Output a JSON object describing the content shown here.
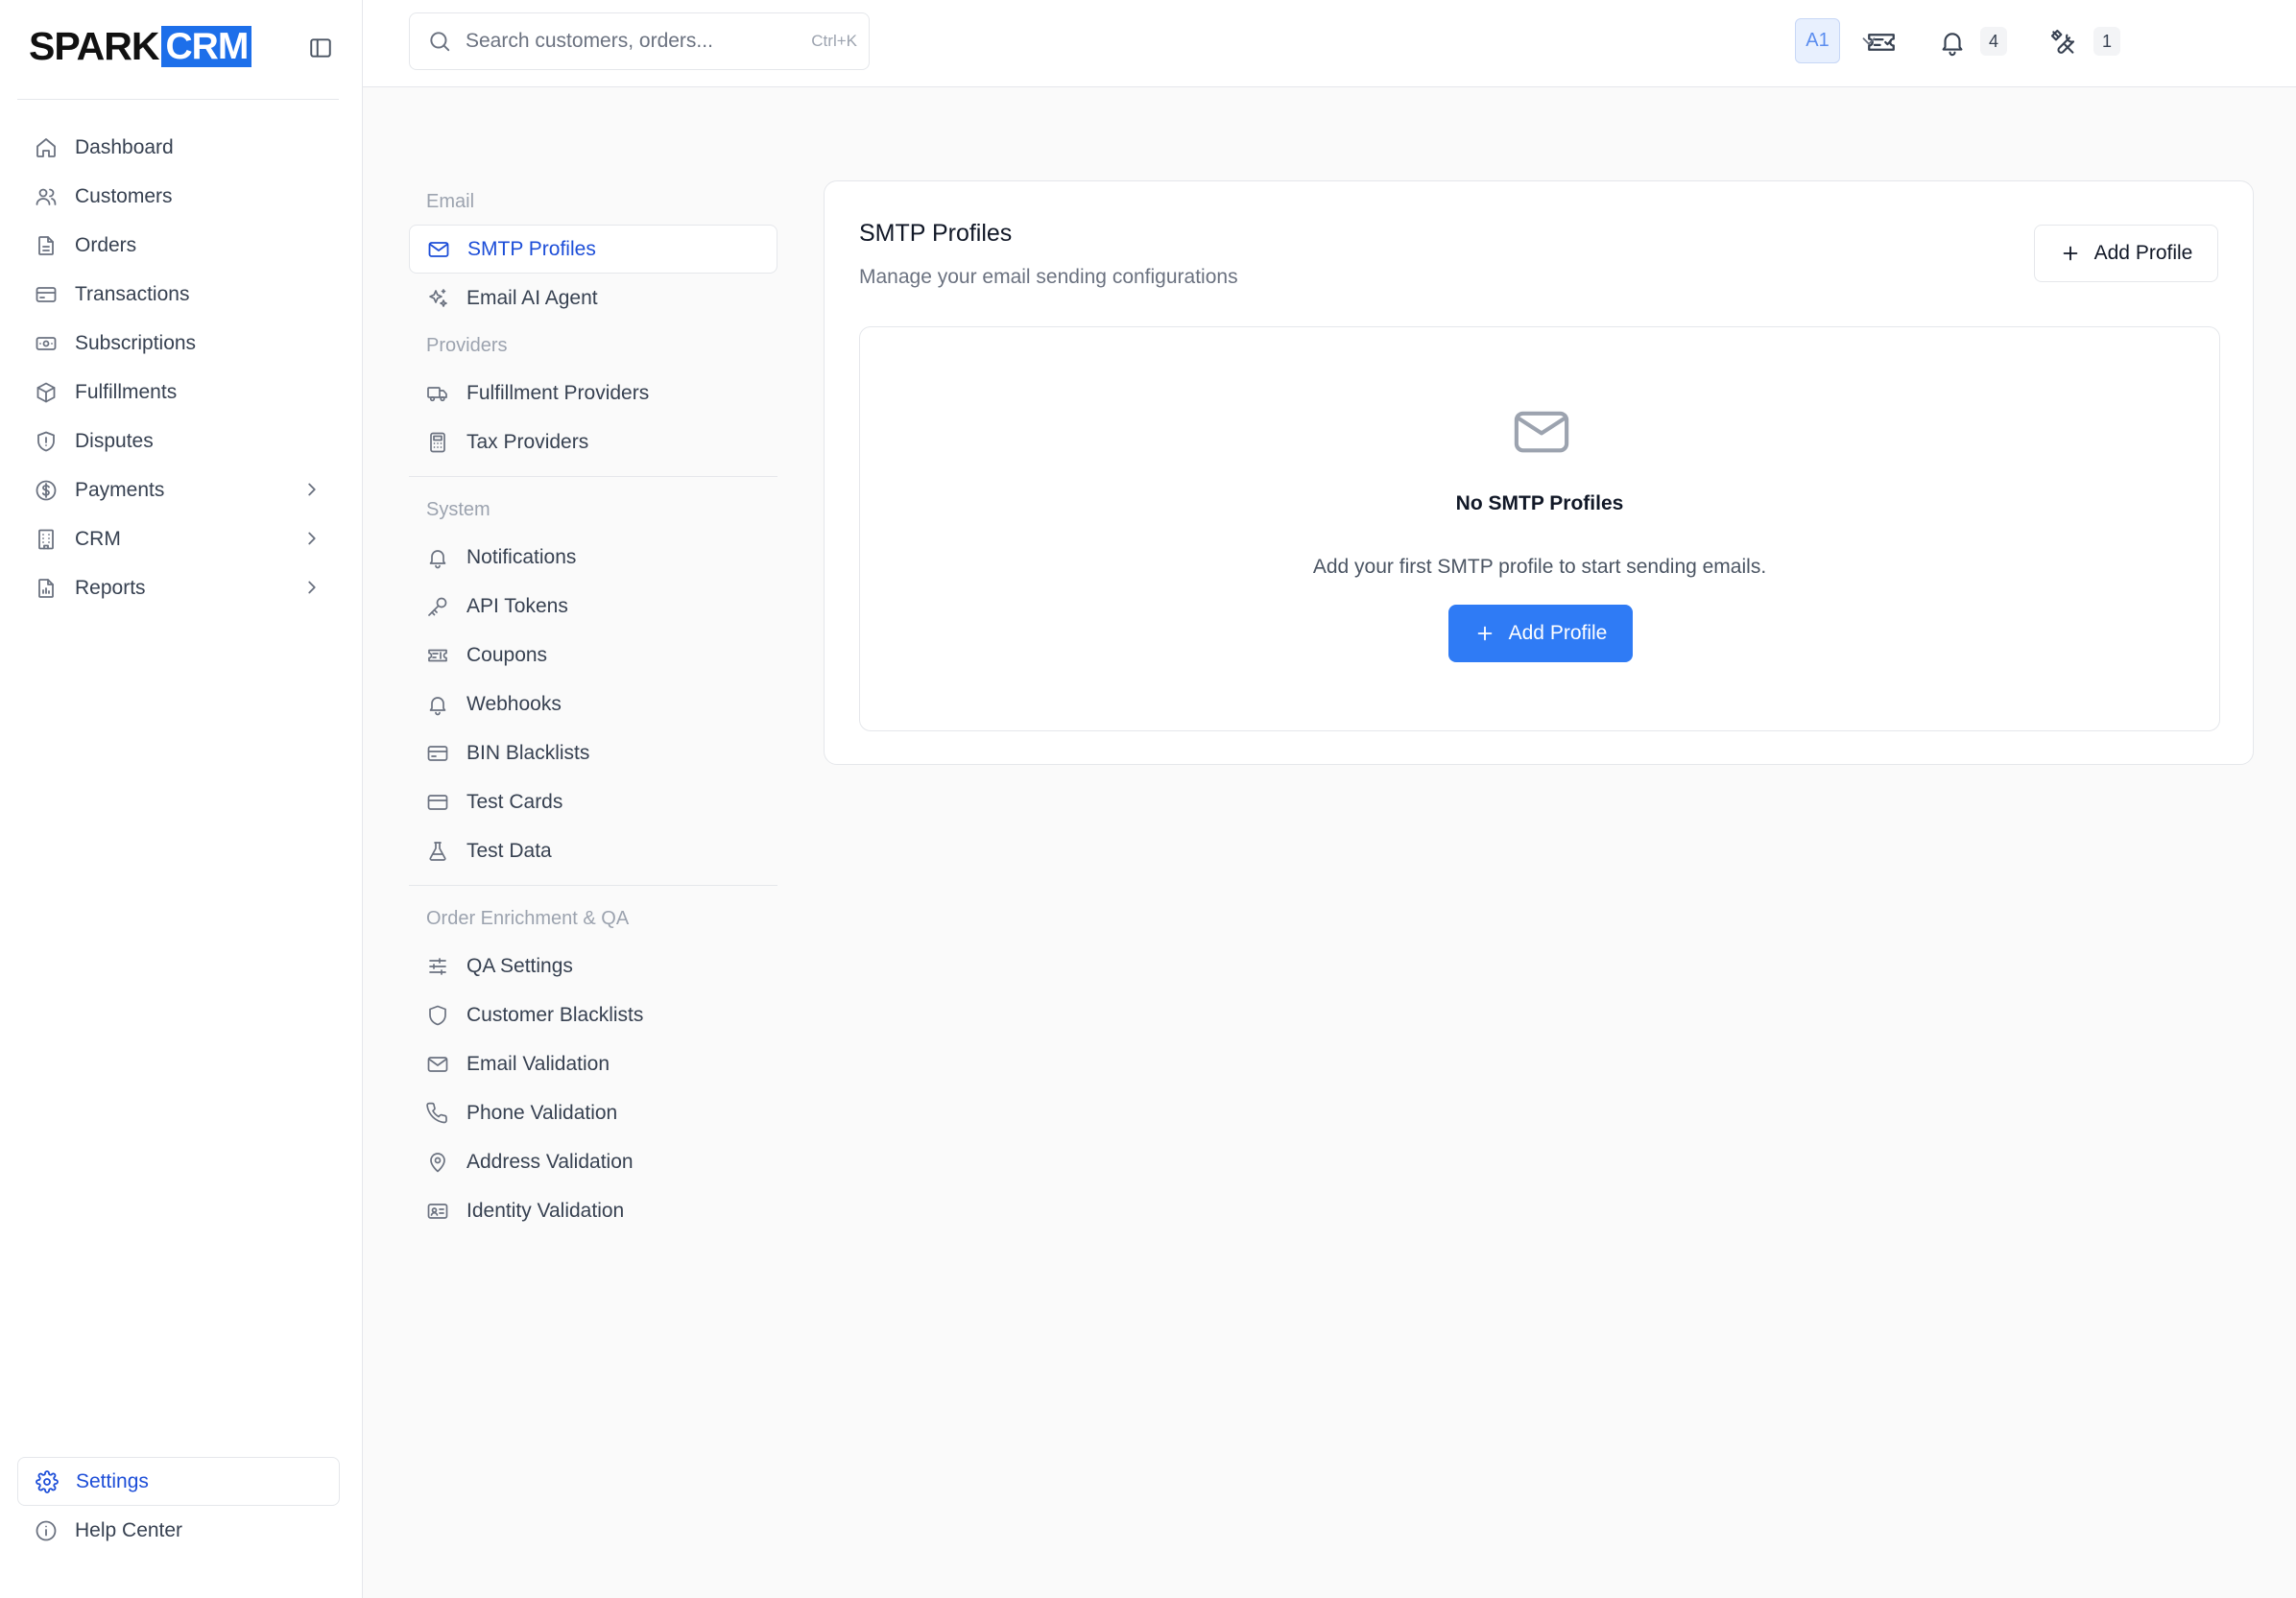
{
  "brand": {
    "part1": "SPARK",
    "part2": "CRM",
    "accent": "#1d6fea"
  },
  "sidebar": {
    "items": [
      {
        "label": "Dashboard",
        "icon": "home-icon"
      },
      {
        "label": "Customers",
        "icon": "users-icon"
      },
      {
        "label": "Orders",
        "icon": "file-icon"
      },
      {
        "label": "Transactions",
        "icon": "credit-card-icon"
      },
      {
        "label": "Subscriptions",
        "icon": "banknote-icon"
      },
      {
        "label": "Fulfillments",
        "icon": "package-icon"
      },
      {
        "label": "Disputes",
        "icon": "shield-icon"
      },
      {
        "label": "Payments",
        "icon": "dollar-circle-icon",
        "has_children": true
      },
      {
        "label": "CRM",
        "icon": "building-icon",
        "has_children": true
      },
      {
        "label": "Reports",
        "icon": "report-icon",
        "has_children": true
      }
    ],
    "bottom": [
      {
        "label": "Settings",
        "icon": "gear-icon",
        "active": true
      },
      {
        "label": "Help Center",
        "icon": "info-icon"
      }
    ]
  },
  "topbar": {
    "search_placeholder": "Search customers, orders...",
    "search_shortcut": "Ctrl+K",
    "notifications_count": "4",
    "tools_count": "1",
    "avatar_initials": "A1"
  },
  "settings_nav": {
    "sections": [
      {
        "heading": "Email",
        "items": [
          {
            "label": "SMTP Profiles",
            "icon": "mail-icon",
            "active": true
          },
          {
            "label": "Email AI Agent",
            "icon": "sparkles-icon"
          }
        ]
      },
      {
        "heading": "Providers",
        "items": [
          {
            "label": "Fulfillment Providers",
            "icon": "truck-icon"
          },
          {
            "label": "Tax Providers",
            "icon": "calculator-icon"
          }
        ]
      },
      {
        "heading": "System",
        "items": [
          {
            "label": "Notifications",
            "icon": "bell-icon"
          },
          {
            "label": "API Tokens",
            "icon": "key-icon"
          },
          {
            "label": "Coupons",
            "icon": "ticket-icon"
          },
          {
            "label": "Webhooks",
            "icon": "webhook-icon"
          },
          {
            "label": "BIN Blacklists",
            "icon": "credit-card-icon"
          },
          {
            "label": "Test Cards",
            "icon": "credit-card-icon"
          },
          {
            "label": "Test Data",
            "icon": "flask-icon"
          }
        ]
      },
      {
        "heading": "Order Enrichment & QA",
        "items": [
          {
            "label": "QA Settings",
            "icon": "sliders-icon"
          },
          {
            "label": "Customer Blacklists",
            "icon": "shield-icon"
          },
          {
            "label": "Email Validation",
            "icon": "mail-icon"
          },
          {
            "label": "Phone Validation",
            "icon": "phone-icon"
          },
          {
            "label": "Address Validation",
            "icon": "map-pin-icon"
          },
          {
            "label": "Identity Validation",
            "icon": "id-card-icon"
          }
        ]
      }
    ]
  },
  "main": {
    "title": "SMTP Profiles",
    "subtitle": "Manage your email sending configurations",
    "add_button": "Add Profile",
    "empty": {
      "title": "No SMTP Profiles",
      "text": "Add your first SMTP profile to start sending emails.",
      "button": "Add Profile"
    }
  }
}
